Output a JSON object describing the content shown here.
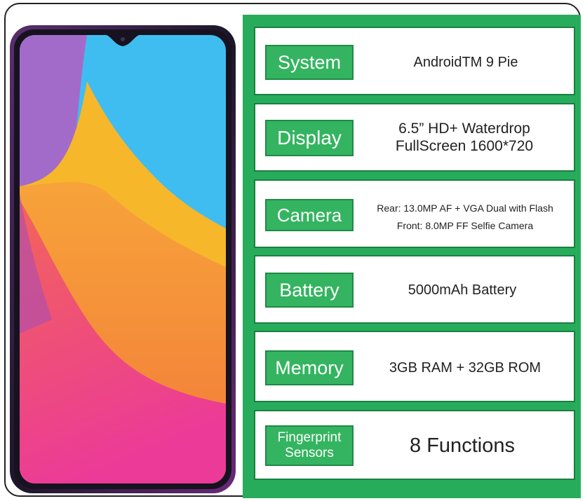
{
  "colors": {
    "panel_green": "#27ac5c",
    "label_green": "#34b460",
    "phone_bezel": "#1c1628",
    "screen_blue": "#3fbdf0",
    "screen_yellow": "#f7b52a",
    "screen_orange": "#f58f2a",
    "screen_pink": "#ef3f8a",
    "screen_purple": "#9c4fb8"
  },
  "specs": [
    {
      "label": "System",
      "value": "AndroidTM 9 Pie"
    },
    {
      "label": "Display",
      "value_line1": "6.5” HD+ Waterdrop",
      "value_line2": "FullScreen 1600*720"
    },
    {
      "label": "Camera",
      "value_line1": "Rear: 13.0MP AF + VGA Dual with Flash",
      "value_line2": "Front: 8.0MP FF Selfie Camera"
    },
    {
      "label": "Battery",
      "value": "5000mAh Battery"
    },
    {
      "label": "Memory",
      "value": "3GB RAM + 32GB ROM"
    },
    {
      "label_line1": "Fingerprint",
      "label_line2": "Sensors",
      "value": "8 Functions"
    }
  ]
}
